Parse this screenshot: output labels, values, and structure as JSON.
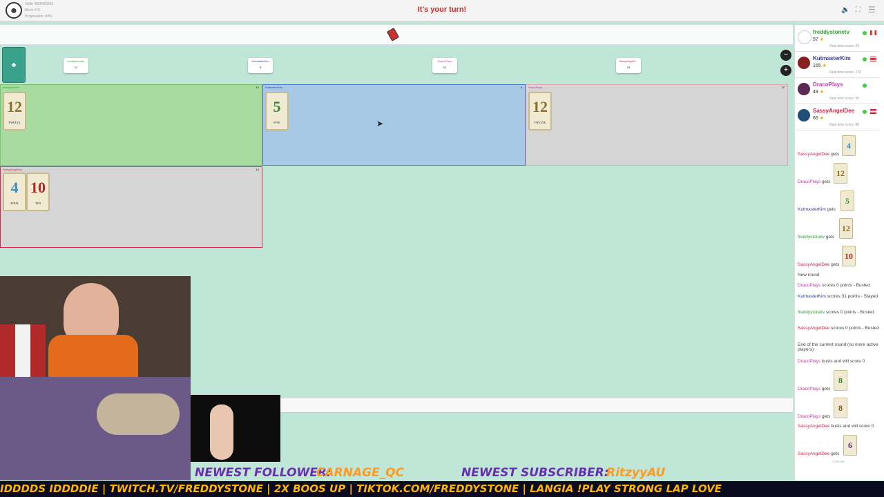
{
  "topbar": {
    "table_label": "Table #826420963",
    "move_label": "Move #72",
    "progression_label": "Progression: 83%",
    "turn_message": "It's your turn!"
  },
  "board": {
    "labels": [
      {
        "name": "freddystonetv",
        "score": "12",
        "color": "#2e9f2e"
      },
      {
        "name": "KutmasterKim",
        "score": "5",
        "color": "#2f3aa6"
      },
      {
        "name": "DracoPlays",
        "score": "12",
        "color": "#c03aa6"
      },
      {
        "name": "SassyAngelD...",
        "score": "14",
        "color": "#d5264b"
      }
    ],
    "panels": [
      {
        "name": "freddystonetv",
        "score": "12",
        "color": "#2e9f2e",
        "cards": [
          {
            "num": "12",
            "word": "TWELVE",
            "color": "#8b6d2c"
          }
        ]
      },
      {
        "name": "KutmasterKim",
        "score": "5",
        "color": "#2f3aa6",
        "cards": [
          {
            "num": "5",
            "word": "FIVE",
            "color": "#3d8a34"
          }
        ]
      },
      {
        "name": "DracoPlays",
        "score": "12",
        "color": "#c03aa6",
        "cards": [
          {
            "num": "12",
            "word": "TWELVE",
            "color": "#8b6d2c"
          }
        ]
      },
      {
        "name": "SassyAngelDee",
        "score": "14",
        "color": "#d5264b",
        "cards": [
          {
            "num": "4",
            "word": "FOUR",
            "color": "#3a8fbf"
          },
          {
            "num": "10",
            "word": "TEN",
            "color": "#b02a2a"
          }
        ]
      }
    ]
  },
  "players": [
    {
      "name": "freddystonetv",
      "score": "57",
      "realtime": "Real time score: 69",
      "color": "#2e9f2e",
      "avatar_color": "#ffffff"
    },
    {
      "name": "KutmasterKim",
      "score": "165",
      "realtime": "Real time score: 170",
      "color": "#2f3aa6",
      "avatar_color": "#8a1f1f"
    },
    {
      "name": "DracoPlays",
      "score": "48",
      "realtime": "Real time score: 60",
      "color": "#c03aa6",
      "avatar_color": "#5a2a55"
    },
    {
      "name": "SassyAngelDee",
      "score": "66",
      "realtime": "Real time score: 80",
      "color": "#d5264b",
      "avatar_color": "#1f4e79"
    }
  ],
  "log": {
    "gets_word": "gets",
    "card_events": [
      {
        "player": "SassyAngelDee",
        "color": "#d5264b",
        "card": "4",
        "card_color": "#3a8fbf"
      },
      {
        "player": "DracoPlays",
        "color": "#c03aa6",
        "card": "12",
        "card_color": "#8b6d2c"
      },
      {
        "player": "KutmasterKim",
        "color": "#2f3aa6",
        "card": "5",
        "card_color": "#3d8a34"
      },
      {
        "player": "freddystonetv",
        "color": "#2e9f2e",
        "card": "12",
        "card_color": "#8b6d2c"
      },
      {
        "player": "SassyAngelDee",
        "color": "#d5264b",
        "card": "10",
        "card_color": "#b02a2a"
      }
    ],
    "new_round": "New round",
    "score_lines": [
      {
        "player": "DracoPlays",
        "color": "#c03aa6",
        "text": "scores 0 points - Busted"
      },
      {
        "player": "KutmasterKim",
        "color": "#2f3aa6",
        "text": "scores 31 points - Stayed"
      },
      {
        "player": "freddystonetv",
        "color": "#2e9f2e",
        "text": "scores 0 points - Busted"
      },
      {
        "player": "SassyAngelDee",
        "color": "#d5264b",
        "text": "scores 0 points - Busted"
      }
    ],
    "end_round": "End of the current round (no more active players)",
    "bust_draco": {
      "player": "DracoPlays",
      "color": "#c03aa6",
      "text": "busts and will score 0"
    },
    "draco_gets_1": {
      "player": "DracoPlays",
      "color": "#c03aa6",
      "card": "8",
      "card_color": "#3d8a34"
    },
    "draco_gets_2": {
      "player": "DracoPlays",
      "color": "#c03aa6",
      "card": "8",
      "card_color": "#7a5a2a"
    },
    "bust_sassy": {
      "player": "SassyAngelDee",
      "color": "#d5264b",
      "text": "busts and will score 0"
    },
    "sassy_gets": {
      "player": "SassyAngelDee",
      "color": "#d5264b",
      "card": "6",
      "card_color": "#5a2a80"
    },
    "timestamp": "07:44 AM"
  },
  "stream": {
    "follower_label": "NEWEST FOLLOWER:",
    "follower_name": "CARNAGE_QC",
    "subscriber_label": "NEWEST SUBSCRIBER:",
    "subscriber_name": "RitzyyAU",
    "ticker": "IDDDDS IDDDDIE | TWITCH.TV/FREDDYSTONE | 2X BOOS UP | TIKTOK.COM/FREDDYSTONE | LANGIA !PLAY STRONG LAP LOVE"
  }
}
